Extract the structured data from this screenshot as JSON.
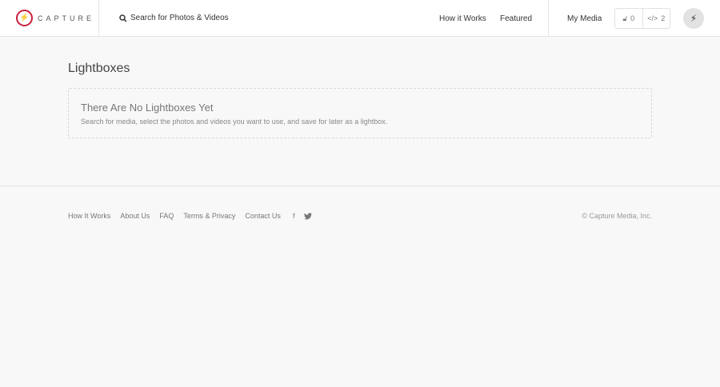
{
  "header": {
    "brand": "CAPTURE",
    "search_label": "Search for Photos & Videos",
    "nav": [
      "How it Works",
      "Featured",
      "My Media"
    ],
    "lightbox_count": "0",
    "embed_count": "2",
    "accent": "#c8203f"
  },
  "main": {
    "title": "Lightboxes",
    "empty_title": "There Are No Lightboxes Yet",
    "empty_text": "Search for media, select the photos and videos you want to use, and save for later as a lightbox."
  },
  "footer": {
    "links": [
      "How It Works",
      "About Us",
      "FAQ",
      "Terms & Privacy",
      "Contact Us"
    ],
    "facebook": "f",
    "copyright": "© Capture Media, Inc."
  }
}
